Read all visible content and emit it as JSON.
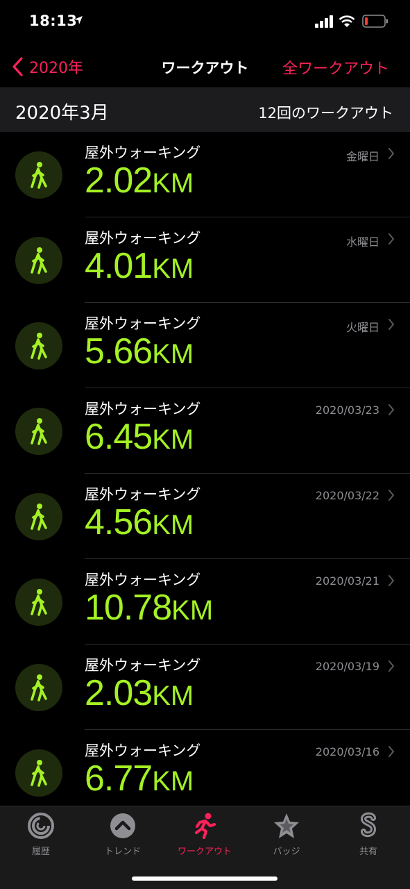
{
  "status": {
    "time": "18:13"
  },
  "nav": {
    "back_label": "2020年",
    "title": "ワークアウト",
    "right_label": "全ワークアウト"
  },
  "section": {
    "month": "2020年3月",
    "count": "12回のワークアウト"
  },
  "workouts": [
    {
      "type": "屋外ウォーキング",
      "distance": "2.02",
      "unit": "KM",
      "date": "金曜日"
    },
    {
      "type": "屋外ウォーキング",
      "distance": "4.01",
      "unit": "KM",
      "date": "水曜日"
    },
    {
      "type": "屋外ウォーキング",
      "distance": "5.66",
      "unit": "KM",
      "date": "火曜日"
    },
    {
      "type": "屋外ウォーキング",
      "distance": "6.45",
      "unit": "KM",
      "date": "2020/03/23"
    },
    {
      "type": "屋外ウォーキング",
      "distance": "4.56",
      "unit": "KM",
      "date": "2020/03/22"
    },
    {
      "type": "屋外ウォーキング",
      "distance": "10.78",
      "unit": "KM",
      "date": "2020/03/21"
    },
    {
      "type": "屋外ウォーキング",
      "distance": "2.03",
      "unit": "KM",
      "date": "2020/03/19"
    },
    {
      "type": "屋外ウォーキング",
      "distance": "6.77",
      "unit": "KM",
      "date": "2020/03/16"
    }
  ],
  "tabs": [
    {
      "label": "履歴",
      "icon": "history-rings-icon"
    },
    {
      "label": "トレンド",
      "icon": "trends-chevron-icon"
    },
    {
      "label": "ワークアウト",
      "icon": "running-figure-icon"
    },
    {
      "label": "バッジ",
      "icon": "badge-star-icon"
    },
    {
      "label": "共有",
      "icon": "sharing-s-icon"
    }
  ],
  "colors": {
    "accent": "#fa2259",
    "distance": "#a4f224",
    "secondary": "#8e8e93",
    "icon_bg": "#1f2b0d"
  }
}
